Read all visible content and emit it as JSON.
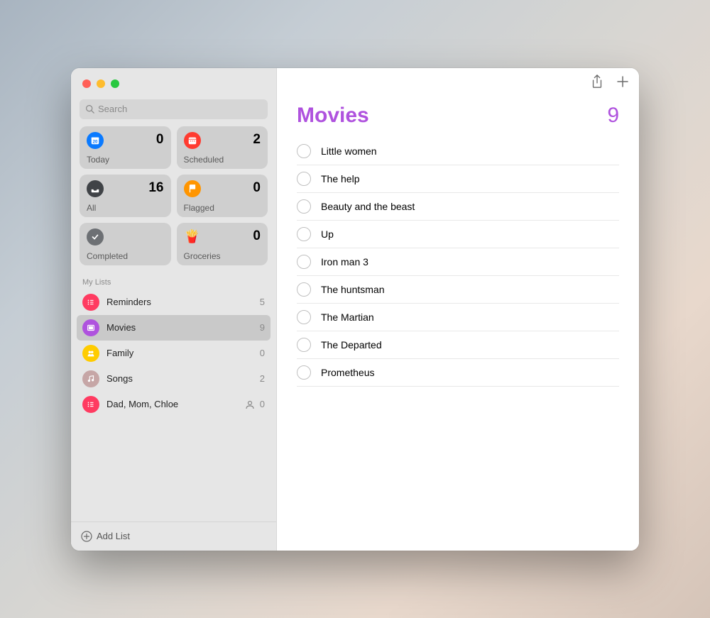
{
  "search": {
    "placeholder": "Search"
  },
  "smartLists": [
    {
      "id": "today",
      "label": "Today",
      "count": 0,
      "iconBg": "#0a7aff"
    },
    {
      "id": "scheduled",
      "label": "Scheduled",
      "count": 2,
      "iconBg": "#ff3b30"
    },
    {
      "id": "all",
      "label": "All",
      "count": 16,
      "iconBg": "#404347"
    },
    {
      "id": "flagged",
      "label": "Flagged",
      "count": 0,
      "iconBg": "#ff9500"
    },
    {
      "id": "completed",
      "label": "Completed",
      "count": "",
      "iconBg": "#6d7074"
    },
    {
      "id": "groceries",
      "label": "Groceries",
      "count": 0,
      "iconBg": ""
    }
  ],
  "myListsHeader": "My Lists",
  "myLists": [
    {
      "id": "reminders",
      "label": "Reminders",
      "count": 5,
      "iconBg": "#ff3b61",
      "selected": false,
      "shared": false
    },
    {
      "id": "movies",
      "label": "Movies",
      "count": 9,
      "iconBg": "#af52de",
      "selected": true,
      "shared": false
    },
    {
      "id": "family",
      "label": "Family",
      "count": 0,
      "iconBg": "#ffcc00",
      "selected": false,
      "shared": false
    },
    {
      "id": "songs",
      "label": "Songs",
      "count": 2,
      "iconBg": "#c6a6a6",
      "selected": false,
      "shared": false
    },
    {
      "id": "shared1",
      "label": "Dad, Mom, Chloe",
      "count": 0,
      "iconBg": "#ff3b61",
      "selected": false,
      "shared": true
    }
  ],
  "addListLabel": "Add List",
  "main": {
    "title": "Movies",
    "count": 9,
    "accentColor": "#af52de",
    "items": [
      {
        "title": "Little women"
      },
      {
        "title": "The help"
      },
      {
        "title": "Beauty and the beast"
      },
      {
        "title": "Up"
      },
      {
        "title": "Iron man 3"
      },
      {
        "title": "The huntsman"
      },
      {
        "title": "The Martian"
      },
      {
        "title": "The Departed"
      },
      {
        "title": "Prometheus"
      }
    ]
  }
}
